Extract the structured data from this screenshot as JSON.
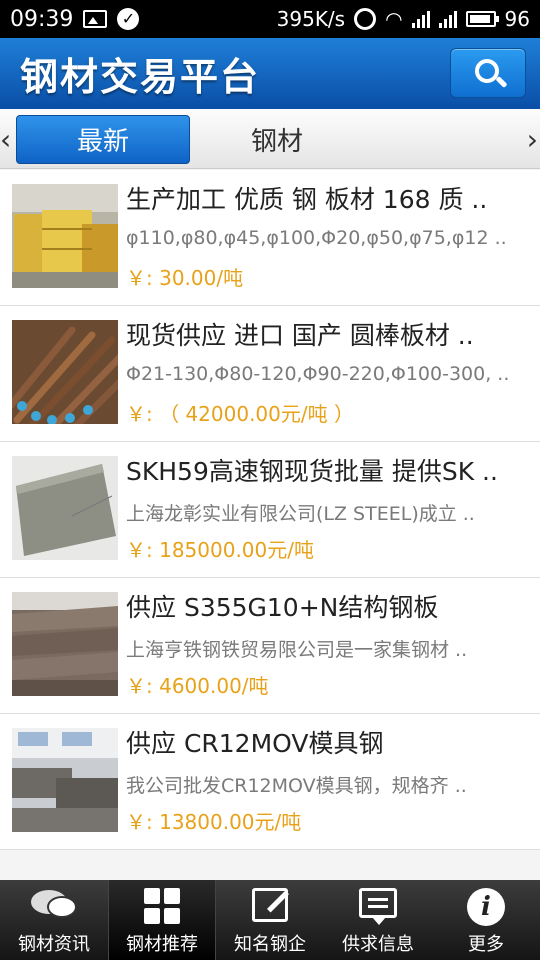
{
  "status_bar": {
    "time": "09:39",
    "speed": "395K/s",
    "network": "3G 2G",
    "battery": "96"
  },
  "header": {
    "title": "钢材交易平台"
  },
  "tabs": {
    "left_arrow": "‹",
    "right_arrow": "›",
    "items": [
      {
        "label": "最新"
      },
      {
        "label": "钢材"
      }
    ]
  },
  "products": [
    {
      "title": "生产加工 优质 钢 板材 168 质 ..",
      "desc": "φ110,φ80,φ45,φ100,Φ20,φ50,φ75,φ12 ..",
      "price": "￥: 30.00/吨"
    },
    {
      "title": "现货供应 进口 国产 圆棒板材 ..",
      "desc": "Φ21-130,Φ80-120,Φ90-220,Φ100-300, ..",
      "price": "￥: （ 42000.00元/吨 ）"
    },
    {
      "title": "SKH59高速钢现货批量 提供SK ..",
      "desc": "上海龙彰实业有限公司(LZ STEEL)成立 ..",
      "price": "￥: 185000.00元/吨"
    },
    {
      "title": "供应 S355G10+N结构钢板",
      "desc": "上海亨铁钢铁贸易限公司是一家集钢材 ..",
      "price": "￥: 4600.00/吨"
    },
    {
      "title": "供应 CR12MOV模具钢",
      "desc": "我公司批发CR12MOV模具钢，规格齐 ..",
      "price": "￥: 13800.00元/吨"
    }
  ],
  "bottom_nav": [
    {
      "label": "钢材资讯",
      "icon": "chat-icon"
    },
    {
      "label": "钢材推荐",
      "icon": "grid-icon"
    },
    {
      "label": "知名钢企",
      "icon": "edit-icon"
    },
    {
      "label": "供求信息",
      "icon": "message-icon"
    },
    {
      "label": "更多",
      "icon": "info-icon"
    }
  ],
  "colors": {
    "header_blue": "#0a4ea6",
    "price_orange": "#e8a21a",
    "active_tab": "#0f63c6"
  }
}
